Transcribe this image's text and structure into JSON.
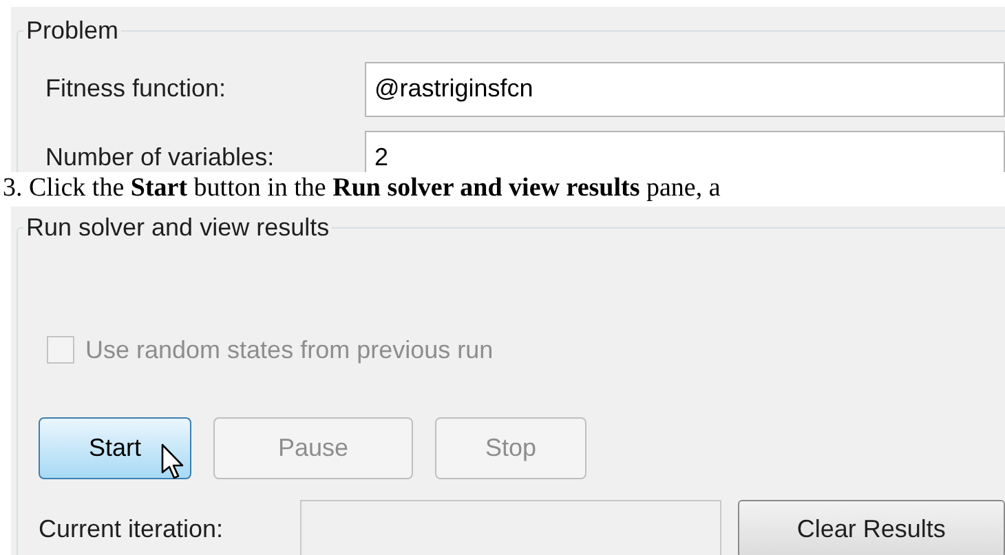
{
  "problem": {
    "title": "Problem",
    "fields": [
      {
        "label": "Fitness function:",
        "value": "@rastriginsfcn"
      },
      {
        "label": "Number of variables:",
        "value": "2"
      }
    ]
  },
  "instruction": "3. Click the **Start** button in the **Run solver and view results** pane, a",
  "run": {
    "title": "Run solver and view results",
    "checkbox": {
      "label": "Use random states from previous run",
      "checked": false,
      "disabled": true
    },
    "buttons": [
      {
        "label": "Start",
        "disabled": false,
        "highlighted": true
      },
      {
        "label": "Pause",
        "disabled": true,
        "highlighted": false
      },
      {
        "label": "Stop",
        "disabled": true,
        "highlighted": false
      }
    ],
    "iteration": {
      "label": "Current iteration:"
    },
    "clear_button": {
      "label": "Clear Results"
    }
  }
}
